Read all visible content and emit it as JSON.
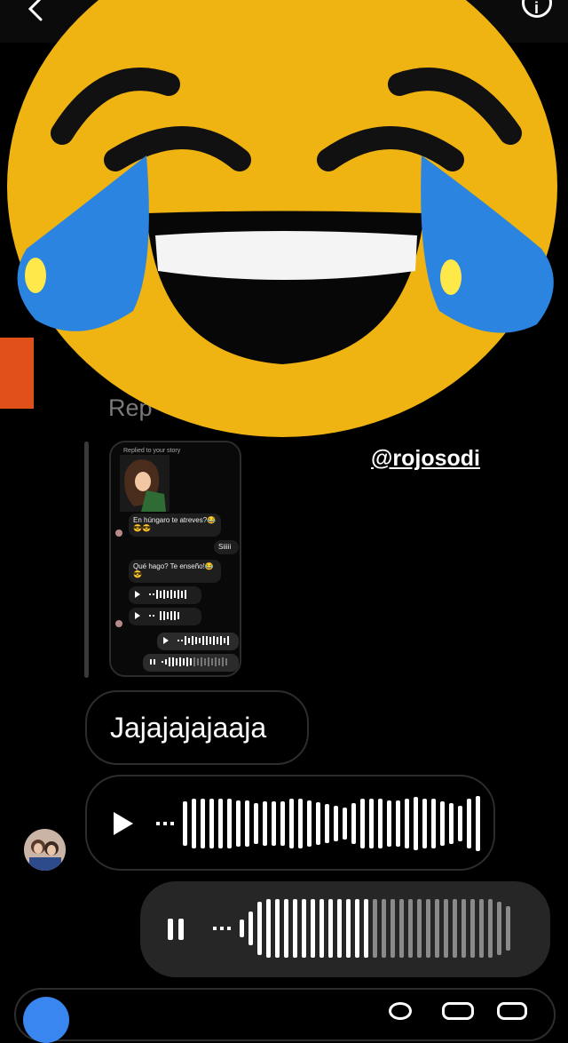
{
  "story_mention": "@rojosodi",
  "reply_label": "Rep",
  "story_preview": {
    "header": "Replied to your story",
    "messages": {
      "m1": "En húngaro te atreves?😂😎😎",
      "m2": "Siiiii",
      "m3": "Qué hago? Te enseño!😂😎"
    }
  },
  "messages": {
    "text_reply": "Jajajajajaaja"
  },
  "colors": {
    "background": "#000000",
    "bubble_border": "#2d2d2d",
    "outgoing_bubble": "#262626",
    "accent_blue": "#3a86f0",
    "emoji_yellow": "#f0b412",
    "tear_blue": "#2b84df"
  },
  "icons": {
    "back": "chevron-left-icon",
    "info": "info-icon",
    "play": "play-icon",
    "pause": "pause-icon",
    "camera": "camera-icon"
  },
  "voice_out_progress": 0.47
}
